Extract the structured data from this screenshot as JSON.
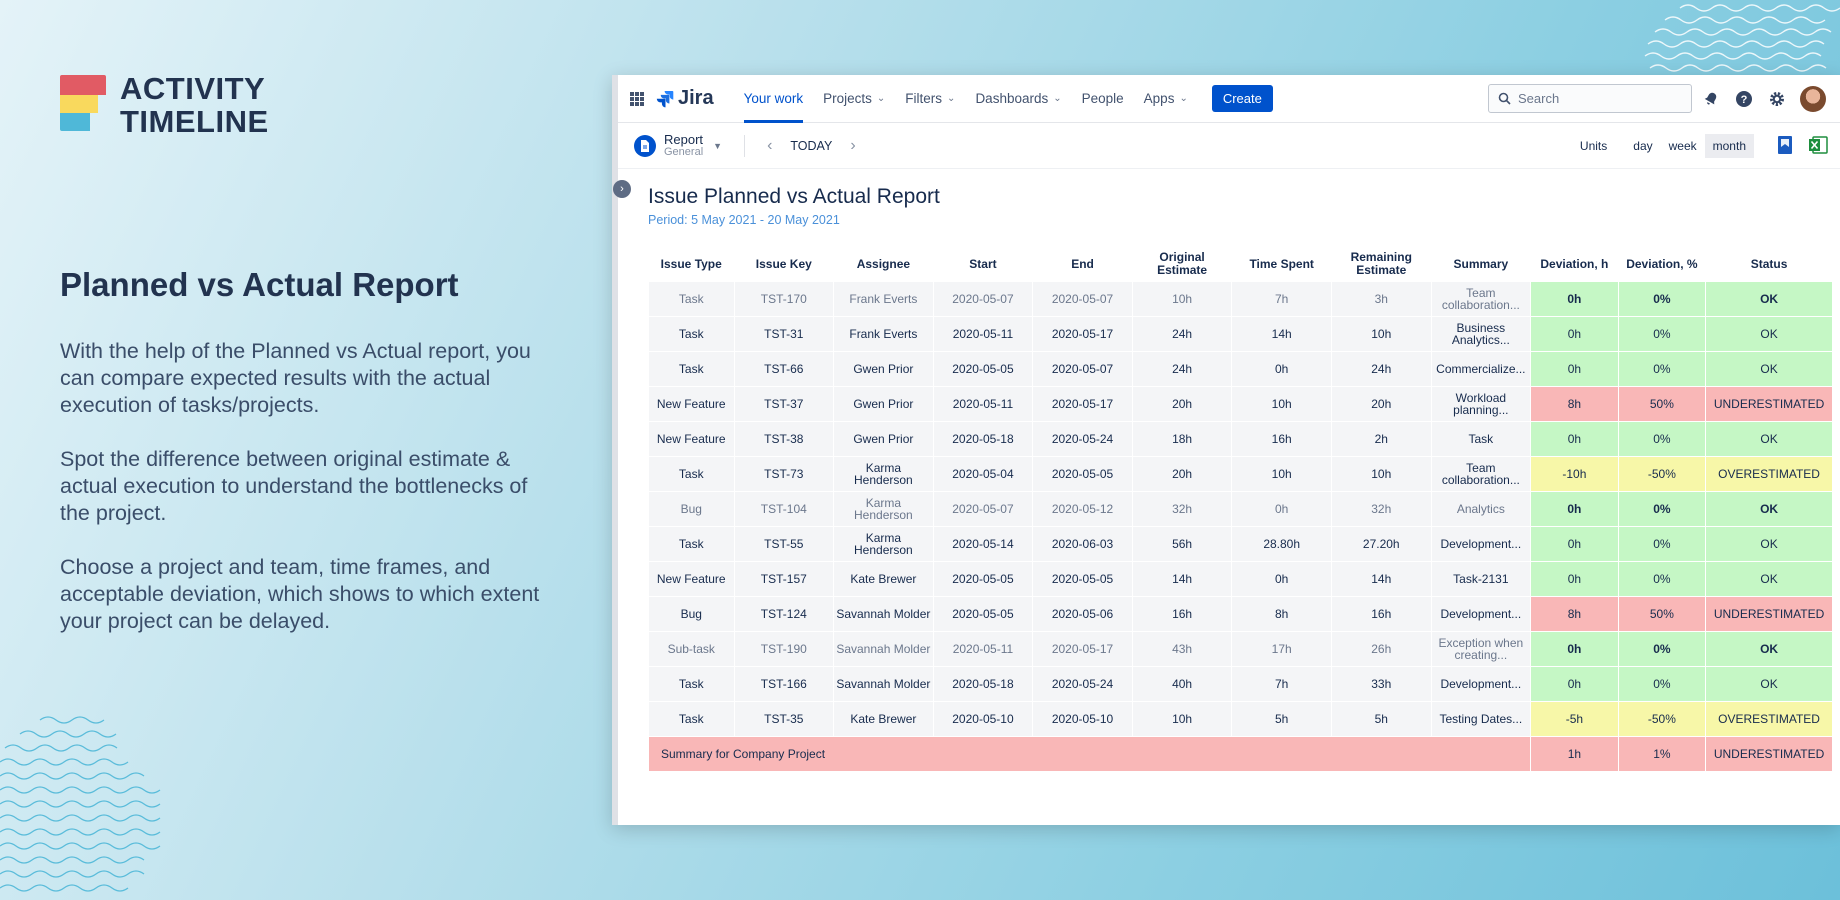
{
  "brand": {
    "line1": "ACTIVITY",
    "line2": "TIMELINE"
  },
  "headline": "Planned vs Actual Report",
  "paragraphs": [
    "With the help of the Planned vs Actual report, you can compare expected results with the actual execution of tasks/projects.",
    "Spot the difference between original estimate & actual execution to understand the bottlenecks of the project.",
    "Choose a project and team, time frames, and acceptable deviation, which shows to which extent your project can be delayed."
  ],
  "jira": {
    "logo": "Jira",
    "nav": {
      "your_work": "Your work",
      "projects": "Projects",
      "filters": "Filters",
      "dashboards": "Dashboards",
      "people": "People",
      "apps": "Apps"
    },
    "create": "Create",
    "search_placeholder": "Search"
  },
  "toolbar": {
    "report": "Report",
    "report_sub": "General",
    "today": "TODAY",
    "units_label": "Units",
    "units": {
      "day": "day",
      "week": "week",
      "month": "month"
    },
    "selected_unit": "month"
  },
  "report": {
    "title": "Issue Planned vs Actual Report",
    "period": "Period: 5 May 2021 - 20 May 2021",
    "headers": {
      "type": "Issue Type",
      "key": "Issue Key",
      "assignee": "Assignee",
      "start": "Start",
      "end": "End",
      "orig": "Original Estimate",
      "spent": "Time Spent",
      "remain": "Remaining Estimate",
      "summary": "Summary",
      "dev_h": "Deviation, h",
      "dev_p": "Deviation, %",
      "status": "Status"
    },
    "rows": [
      {
        "type": "Task",
        "key": "TST-170",
        "assignee": "Frank Everts",
        "start": "2020-05-07",
        "end": "2020-05-07",
        "orig": "10h",
        "spent": "7h",
        "remain": "3h",
        "summary": "Team collaboration...",
        "dev_h": "0h",
        "dev_p": "0%",
        "status": "OK",
        "state": "ok",
        "dim": true
      },
      {
        "type": "Task",
        "key": "TST-31",
        "assignee": "Frank Everts",
        "start": "2020-05-11",
        "end": "2020-05-17",
        "orig": "24h",
        "spent": "14h",
        "remain": "10h",
        "summary": "Business Analytics...",
        "dev_h": "0h",
        "dev_p": "0%",
        "status": "OK",
        "state": "ok",
        "dim": false
      },
      {
        "type": "Task",
        "key": "TST-66",
        "assignee": "Gwen Prior",
        "start": "2020-05-05",
        "end": "2020-05-07",
        "orig": "24h",
        "spent": "0h",
        "remain": "24h",
        "summary": "Commercialize...",
        "dev_h": "0h",
        "dev_p": "0%",
        "status": "OK",
        "state": "ok",
        "dim": false
      },
      {
        "type": "New Feature",
        "key": "TST-37",
        "assignee": "Gwen Prior",
        "start": "2020-05-11",
        "end": "2020-05-17",
        "orig": "20h",
        "spent": "10h",
        "remain": "20h",
        "summary": "Workload planning...",
        "dev_h": "8h",
        "dev_p": "50%",
        "status": "UNDERESTIMATED",
        "state": "under",
        "dim": false
      },
      {
        "type": "New Feature",
        "key": "TST-38",
        "assignee": "Gwen Prior",
        "start": "2020-05-18",
        "end": "2020-05-24",
        "orig": "18h",
        "spent": "16h",
        "remain": "2h",
        "summary": "Task",
        "dev_h": "0h",
        "dev_p": "0%",
        "status": "OK",
        "state": "ok",
        "dim": false
      },
      {
        "type": "Task",
        "key": "TST-73",
        "assignee": "Karma Henderson",
        "start": "2020-05-04",
        "end": "2020-05-05",
        "orig": "20h",
        "spent": "10h",
        "remain": "10h",
        "summary": "Team collaboration...",
        "dev_h": "-10h",
        "dev_p": "-50%",
        "status": "OVERESTIMATED",
        "state": "over",
        "dim": false
      },
      {
        "type": "Bug",
        "key": "TST-104",
        "assignee": "Karma Henderson",
        "start": "2020-05-07",
        "end": "2020-05-12",
        "orig": "32h",
        "spent": "0h",
        "remain": "32h",
        "summary": "Analytics",
        "dev_h": "0h",
        "dev_p": "0%",
        "status": "OK",
        "state": "ok",
        "dim": true
      },
      {
        "type": "Task",
        "key": "TST-55",
        "assignee": "Karma Henderson",
        "start": "2020-05-14",
        "end": "2020-06-03",
        "orig": "56h",
        "spent": "28.80h",
        "remain": "27.20h",
        "summary": "Development...",
        "dev_h": "0h",
        "dev_p": "0%",
        "status": "OK",
        "state": "ok",
        "dim": false
      },
      {
        "type": "New Feature",
        "key": "TST-157",
        "assignee": "Kate Brewer",
        "start": "2020-05-05",
        "end": "2020-05-05",
        "orig": "14h",
        "spent": "0h",
        "remain": "14h",
        "summary": "Task-2131",
        "dev_h": "0h",
        "dev_p": "0%",
        "status": "OK",
        "state": "ok",
        "dim": false
      },
      {
        "type": "Bug",
        "key": "TST-124",
        "assignee": "Savannah Molder",
        "start": "2020-05-05",
        "end": "2020-05-06",
        "orig": "16h",
        "spent": "8h",
        "remain": "16h",
        "summary": "Development...",
        "dev_h": "8h",
        "dev_p": "50%",
        "status": "UNDERESTIMATED",
        "state": "under",
        "dim": false
      },
      {
        "type": "Sub-task",
        "key": "TST-190",
        "assignee": "Savannah Molder",
        "start": "2020-05-11",
        "end": "2020-05-17",
        "orig": "43h",
        "spent": "17h",
        "remain": "26h",
        "summary": "Exception when creating...",
        "dev_h": "0h",
        "dev_p": "0%",
        "status": "OK",
        "state": "ok",
        "dim": true
      },
      {
        "type": "Task",
        "key": "TST-166",
        "assignee": "Savannah Molder",
        "start": "2020-05-18",
        "end": "2020-05-24",
        "orig": "40h",
        "spent": "7h",
        "remain": "33h",
        "summary": "Development...",
        "dev_h": "0h",
        "dev_p": "0%",
        "status": "OK",
        "state": "ok",
        "dim": false
      },
      {
        "type": "Task",
        "key": "TST-35",
        "assignee": "Kate Brewer",
        "start": "2020-05-10",
        "end": "2020-05-10",
        "orig": "10h",
        "spent": "5h",
        "remain": "5h",
        "summary": "Testing Dates...",
        "dev_h": "-5h",
        "dev_p": "-50%",
        "status": "OVERESTIMATED",
        "state": "over",
        "dim": false
      }
    ],
    "summary_row": {
      "label": "Summary for Company Project",
      "dev_h": "1h",
      "dev_p": "1%",
      "status": "UNDERESTIMATED"
    }
  },
  "colors": {
    "ok": "#c5f7c5",
    "over": "#f7f7a8",
    "under": "#f9b7b7",
    "accent": "#0052cc"
  }
}
